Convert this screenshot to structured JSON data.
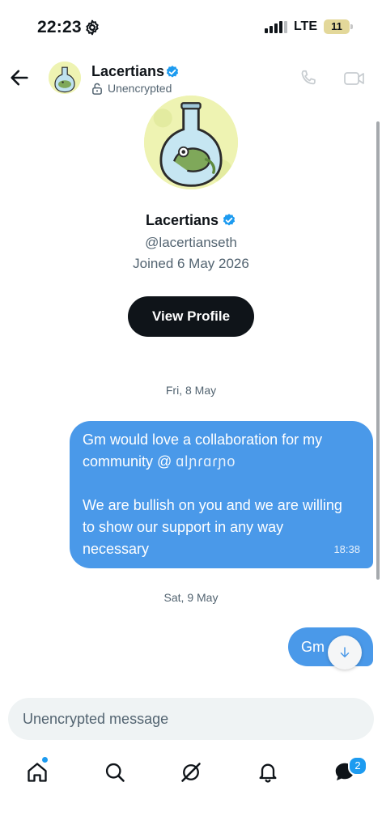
{
  "status_bar": {
    "time": "22:23",
    "network": "LTE",
    "battery": "11"
  },
  "header": {
    "name": "Lacertians",
    "encryption": "Unencrypted"
  },
  "profile": {
    "name": "Lacertians",
    "handle": "@lacertianseth",
    "joined": "Joined 6 May 2026",
    "view_profile_label": "View Profile"
  },
  "messages": [
    {
      "date": "Fri, 8 May",
      "lines": [
        "Gm would love  a collaboration for my",
        "community @ ",
        "",
        "We are bullish on you and we are willing",
        "to show our support in any way",
        "necessary"
      ],
      "mention_obscured": "ɑlɲɾɑɾɲo",
      "time": "18:38"
    },
    {
      "date": "Sat, 9 May",
      "text": "Gm"
    }
  ],
  "composer": {
    "placeholder": "Unencrypted message"
  },
  "nav": {
    "messages_badge": "2"
  },
  "colors": {
    "accent": "#1d9bf0",
    "bubble": "#4a99e9",
    "primary_text": "#0f1419",
    "secondary_text": "#536471"
  },
  "icons": [
    "gear-icon",
    "back-arrow-icon",
    "verified-badge-icon",
    "lock-open-icon",
    "phone-icon",
    "video-icon",
    "arrow-down-icon",
    "home-icon",
    "search-icon",
    "grok-icon",
    "bell-icon",
    "messages-icon"
  ]
}
